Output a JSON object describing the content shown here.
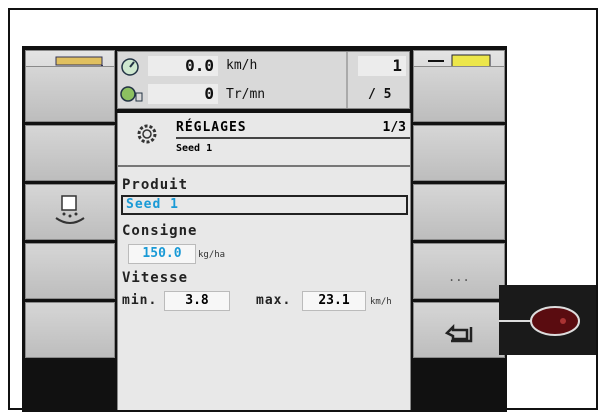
{
  "speed": {
    "value": "0.0",
    "unit": "km/h"
  },
  "rpm": {
    "value": "0",
    "unit": "Tr/mn"
  },
  "page_counter": {
    "current": "1",
    "total": "/ 5"
  },
  "settings": {
    "title": "RÉGLAGES",
    "page": "1/3",
    "subtitle": "Seed 1",
    "product_label": "Produit",
    "product_value": "Seed 1",
    "setpoint_label": "Consigne",
    "setpoint_value": "150.0",
    "setpoint_unit": "kg/ha",
    "speed_label": "Vitesse",
    "min_label": "min.",
    "min_value": "3.8",
    "max_label": "max.",
    "max_value": "23.1",
    "speed_unit": "km/h"
  },
  "softkeys": {
    "more": "..."
  },
  "icons": [
    "machine-map-icon",
    "speedometer-icon",
    "rpm-gauge-icon",
    "section-toggle-icon",
    "gear-icon",
    "seed-hopper-icon",
    "back-arrow-icon",
    "joystick-icon"
  ]
}
